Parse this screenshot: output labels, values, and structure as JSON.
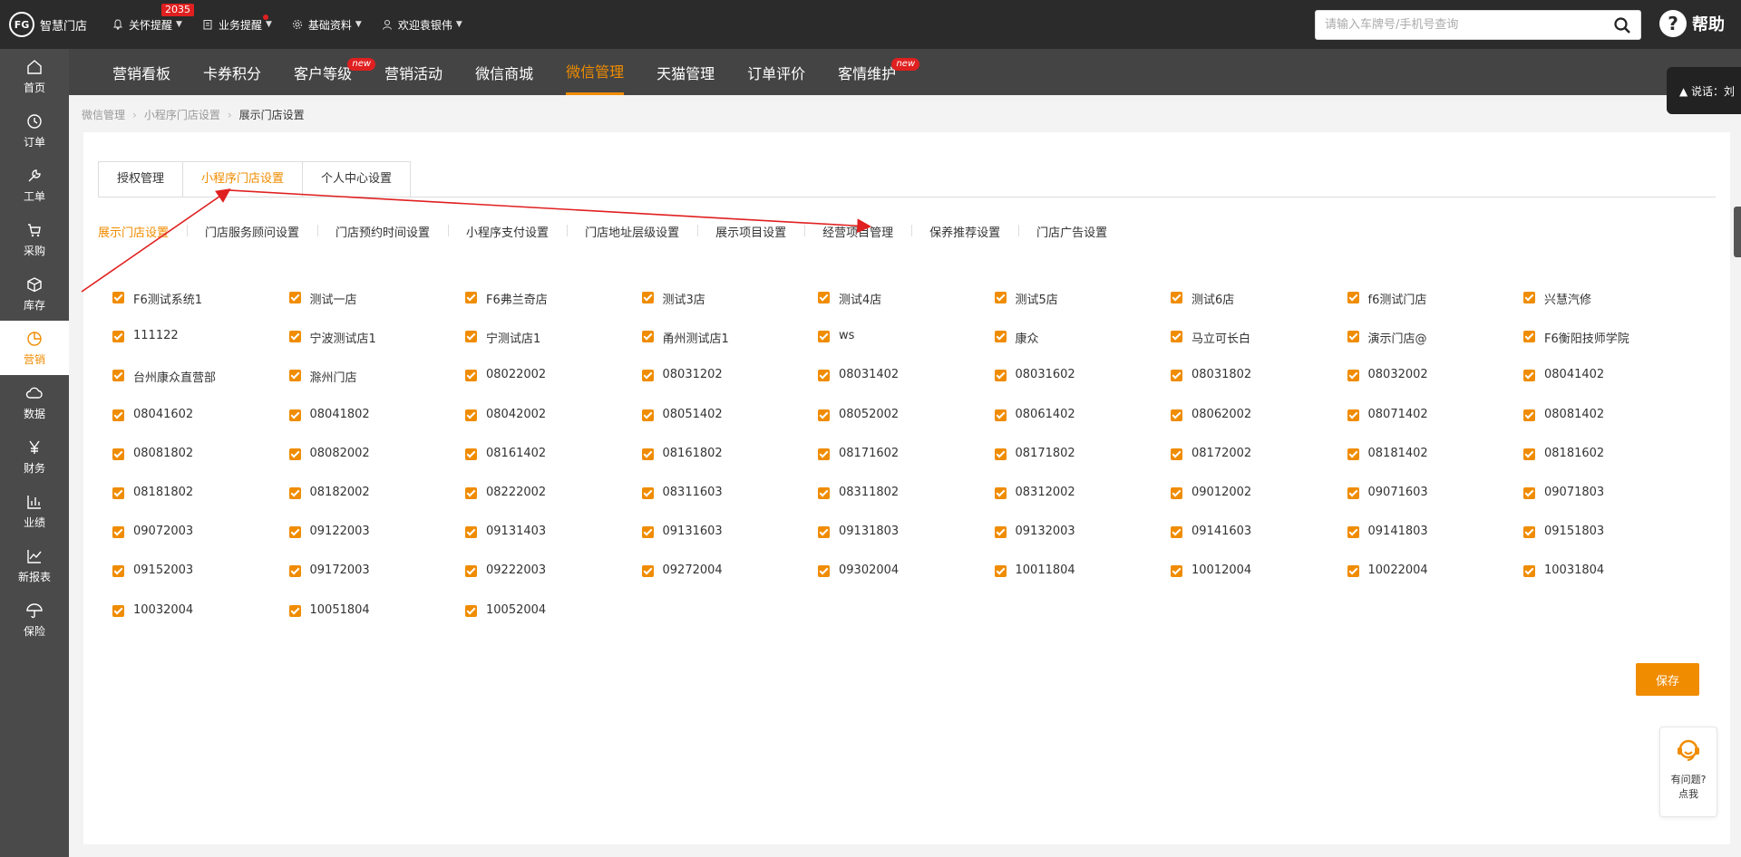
{
  "app": {
    "logo_text": "智慧门店",
    "logo_mark": "FG"
  },
  "topnav": [
    {
      "label": "关怀提醒",
      "icon": "bell-icon",
      "badge": "2035"
    },
    {
      "label": "业务提醒",
      "icon": "clipboard-icon",
      "dot": true
    },
    {
      "label": "基础资料",
      "icon": "gear-icon"
    },
    {
      "label": "欢迎袁银伟",
      "icon": "user-icon"
    }
  ],
  "search": {
    "placeholder": "请输入车牌号/手机号查询"
  },
  "help": {
    "label": "帮助",
    "glyph": "?"
  },
  "sidebar": [
    {
      "label": "首页",
      "icon": "home-icon"
    },
    {
      "label": "订单",
      "icon": "clock-icon"
    },
    {
      "label": "工单",
      "icon": "wrench-icon"
    },
    {
      "label": "采购",
      "icon": "cart-icon"
    },
    {
      "label": "库存",
      "icon": "box-icon"
    },
    {
      "label": "营销",
      "icon": "pie-icon",
      "active": true
    },
    {
      "label": "数据",
      "icon": "cloud-icon"
    },
    {
      "label": "财务",
      "icon": "yen-icon"
    },
    {
      "label": "业绩",
      "icon": "bar-chart-icon"
    },
    {
      "label": "新报表",
      "icon": "line-chart-icon"
    },
    {
      "label": "保险",
      "icon": "umbrella-icon"
    }
  ],
  "modnav": [
    {
      "label": "营销看板"
    },
    {
      "label": "卡券积分"
    },
    {
      "label": "客户等级",
      "new": "new"
    },
    {
      "label": "营销活动"
    },
    {
      "label": "微信商城"
    },
    {
      "label": "微信管理",
      "active": true
    },
    {
      "label": "天猫管理"
    },
    {
      "label": "订单评价"
    },
    {
      "label": "客情维护",
      "new": "new"
    }
  ],
  "float_tip": {
    "text": "▲ 说话：刘"
  },
  "breadcrumb": [
    "微信管理",
    "小程序门店设置",
    "展示门店设置"
  ],
  "tabs": [
    {
      "label": "授权管理"
    },
    {
      "label": "小程序门店设置",
      "active": true
    },
    {
      "label": "个人中心设置"
    }
  ],
  "subtabs": [
    {
      "label": "展示门店设置",
      "active": true
    },
    {
      "label": "门店服务顾问设置"
    },
    {
      "label": "门店预约时间设置"
    },
    {
      "label": "小程序支付设置"
    },
    {
      "label": "门店地址层级设置"
    },
    {
      "label": "展示项目设置"
    },
    {
      "label": "经营项目管理"
    },
    {
      "label": "保养推荐设置"
    },
    {
      "label": "门店广告设置"
    }
  ],
  "stores": [
    "F6测试系统1",
    "测试一店",
    "F6弗兰奇店",
    "测试3店",
    "测试4店",
    "测试5店",
    "测试6店",
    "f6测试门店",
    "兴慧汽修",
    "111122",
    "宁波测试店1",
    "宁测试店1",
    "甬州测试店1",
    "ws",
    "康众",
    "马立可长白",
    "演示门店@",
    "F6衡阳技师学院",
    "台州康众直营部",
    "滁州门店",
    "08022002",
    "08031202",
    "08031402",
    "08031602",
    "08031802",
    "08032002",
    "08041402",
    "08041602",
    "08041802",
    "08042002",
    "08051402",
    "08052002",
    "08061402",
    "08062002",
    "08071402",
    "08081402",
    "08081802",
    "08082002",
    "08161402",
    "08161802",
    "08171602",
    "08171802",
    "08172002",
    "08181402",
    "08181602",
    "08181802",
    "08182002",
    "08222002",
    "08311603",
    "08311802",
    "08312002",
    "09012002",
    "09071603",
    "09071803",
    "09072003",
    "09122003",
    "09131403",
    "09131603",
    "09131803",
    "09132003",
    "09141603",
    "09141803",
    "09151803",
    "09152003",
    "09172003",
    "09222003",
    "09272004",
    "09302004",
    "10011804",
    "10012004",
    "10022004",
    "10031804",
    "10032004",
    "10051804",
    "10052004"
  ],
  "save_label": "保存",
  "help_widget": {
    "line1": "有问题?",
    "line2": "点我"
  },
  "colors": {
    "accent": "#f08c00",
    "topbar": "#2b2b2b",
    "sidebar": "#4a4a4a",
    "modnav": "#444444",
    "annotation": "#e02020"
  }
}
